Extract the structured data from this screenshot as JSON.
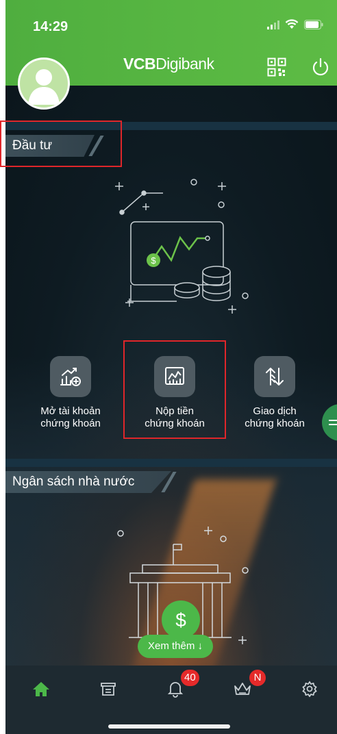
{
  "status_bar": {
    "time": "14:29"
  },
  "header": {
    "brand_bold": "VCB",
    "brand_light": "Digibank",
    "icons": [
      "qr-code-icon",
      "power-icon"
    ]
  },
  "sections": [
    {
      "title": "Đầu tư"
    },
    {
      "title": "Ngân sách nhà nước"
    }
  ],
  "actions": [
    {
      "line1": "Mở tài khoản",
      "line2": "chứng khoán",
      "icon": "open-account-icon"
    },
    {
      "line1": "Nộp tiền",
      "line2": "chứng khoán",
      "icon": "deposit-chart-icon"
    },
    {
      "line1": "Giao dịch",
      "line2": "chứng khoán",
      "icon": "exchange-arrows-icon"
    }
  ],
  "more_button": "Xem thêm ↓",
  "bottom_nav": {
    "items": [
      "home-icon",
      "shop-icon",
      "bell-icon",
      "crown-icon",
      "settings-icon"
    ],
    "notifications_badge": "40",
    "crown_badge": "N"
  },
  "colors": {
    "brand_green": "#58b742",
    "highlight_red": "#e0262a",
    "badge_red": "#e52a2a"
  }
}
